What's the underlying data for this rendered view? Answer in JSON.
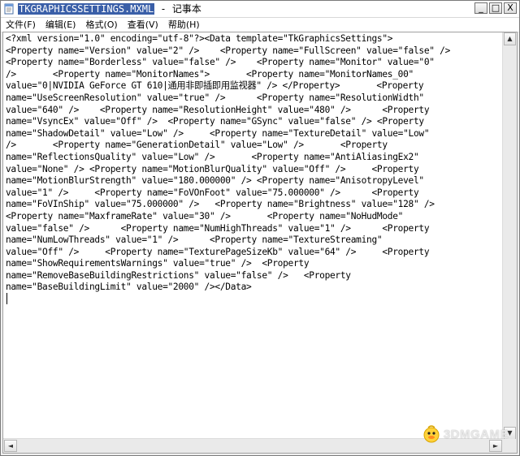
{
  "window": {
    "title_filename": "TKGRAPHICSSETTINGS.MXML",
    "title_suffix": " - 记事本"
  },
  "window_controls": {
    "minimize": "_",
    "maximize": "□",
    "close": "X"
  },
  "menu": {
    "items": [
      "文件(F)",
      "编辑(E)",
      "格式(O)",
      "查看(V)",
      "帮助(H)"
    ]
  },
  "document": {
    "text": "<?xml version=\"1.0\" encoding=\"utf-8\"?><Data template=\"TkGraphicsSettings\">\n<Property name=\"Version\" value=\"2\" />    <Property name=\"FullScreen\" value=\"false\" />\n<Property name=\"Borderless\" value=\"false\" />    <Property name=\"Monitor\" value=\"0\"\n/>       <Property name=\"MonitorNames\">       <Property name=\"MonitorNames_00\"\nvalue=\"0|NVIDIA GeForce GT 610|通用非即插即用监视器\" /> </Property>       <Property\nname=\"UseScreenResolution\" value=\"true\" />      <Property name=\"ResolutionWidth\"\nvalue=\"640\" />    <Property name=\"ResolutionHeight\" value=\"480\" />      <Property\nname=\"VsyncEx\" value=\"Off\" />  <Property name=\"GSync\" value=\"false\" /> <Property\nname=\"ShadowDetail\" value=\"Low\" />     <Property name=\"TextureDetail\" value=\"Low\"\n/>       <Property name=\"GenerationDetail\" value=\"Low\" />       <Property\nname=\"ReflectionsQuality\" value=\"Low\" />       <Property name=\"AntiAliasingEx2\"\nvalue=\"None\" /> <Property name=\"MotionBlurQuality\" value=\"Off\" />     <Property\nname=\"MotionBlurStrength\" value=\"180.000000\" /> <Property name=\"AnisotropyLevel\"\nvalue=\"1\" />     <Property name=\"FoVOnFoot\" value=\"75.000000\" />      <Property\nname=\"FoVInShip\" value=\"75.000000\" />   <Property name=\"Brightness\" value=\"128\" />\n<Property name=\"MaxframeRate\" value=\"30\" />       <Property name=\"NoHudMode\"\nvalue=\"false\" />      <Property name=\"NumHighThreads\" value=\"1\" />      <Property\nname=\"NumLowThreads\" value=\"1\" />      <Property name=\"TextureStreaming\"\nvalue=\"Off\" />     <Property name=\"TexturePageSizeKb\" value=\"64\" />     <Property\nname=\"ShowRequirementsWarnings\" value=\"true\" />  <Property\nname=\"RemoveBaseBuildingRestrictions\" value=\"false\" />   <Property\nname=\"BaseBuildingLimit\" value=\"2000\" /></Data>"
  },
  "scrollbars": {
    "up": "▲",
    "down": "▼",
    "left": "◄",
    "right": "►"
  },
  "watermark": {
    "text": "3DMGAME"
  }
}
